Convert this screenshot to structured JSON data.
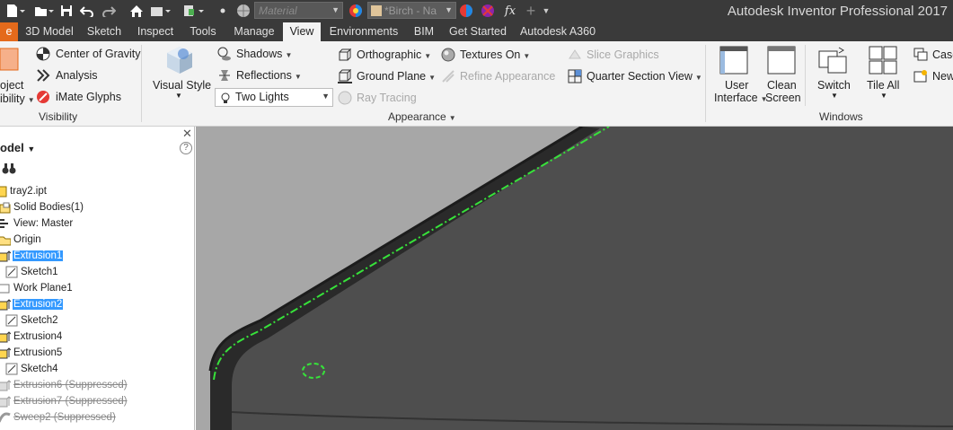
{
  "app_title": "Autodesk Inventor Professional 2017",
  "quick_access": {
    "material_placeholder": "Material",
    "appearance_value": "*Birch - Na",
    "fx_label": "fx"
  },
  "tabs": [
    {
      "label": "e",
      "id": "file"
    },
    {
      "label": "3D Model",
      "id": "3d-model"
    },
    {
      "label": "Sketch",
      "id": "sketch"
    },
    {
      "label": "Inspect",
      "id": "inspect"
    },
    {
      "label": "Tools",
      "id": "tools"
    },
    {
      "label": "Manage",
      "id": "manage"
    },
    {
      "label": "View",
      "id": "view",
      "active": true
    },
    {
      "label": "Environments",
      "id": "environments"
    },
    {
      "label": "BIM",
      "id": "bim"
    },
    {
      "label": "Get Started",
      "id": "get-started"
    },
    {
      "label": "Autodesk A360",
      "id": "a360"
    }
  ],
  "ribbon": {
    "visibility": {
      "title": "Visibility",
      "object_visibility_line1": "oject",
      "object_visibility_line2": "ibility",
      "center_of_gravity": "Center of Gravity",
      "analysis": "Analysis",
      "imate_glyphs": "iMate Glyphs"
    },
    "appearance": {
      "title": "Appearance",
      "visual_style": "Visual Style",
      "shadows": "Shadows",
      "reflections": "Reflections",
      "lighting_value": "Two Lights",
      "orthographic": "Orthographic",
      "ground_plane": "Ground Plane",
      "ray_tracing": "Ray Tracing",
      "textures_on": "Textures On",
      "refine_appearance": "Refine Appearance",
      "slice_graphics": "Slice Graphics",
      "quarter_section_view": "Quarter Section View"
    },
    "windows": {
      "title": "Windows",
      "user_interface_line1": "User",
      "user_interface_line2": "Interface",
      "clean_screen_line1": "Clean",
      "clean_screen_line2": "Screen",
      "switch": "Switch",
      "tile_all": "Tile All",
      "cascade": "Casc",
      "new": "New"
    }
  },
  "browser": {
    "header": "odel",
    "items": [
      {
        "label": "tray2.ipt",
        "state": "normal"
      },
      {
        "label": "Solid Bodies(1)",
        "state": "normal"
      },
      {
        "label": "View: Master",
        "state": "normal"
      },
      {
        "label": "Origin",
        "state": "normal"
      },
      {
        "label": "Extrusion1",
        "state": "selected"
      },
      {
        "label": "Sketch1",
        "state": "normal"
      },
      {
        "label": "Work Plane1",
        "state": "normal"
      },
      {
        "label": "Extrusion2",
        "state": "selected"
      },
      {
        "label": "Sketch2",
        "state": "normal"
      },
      {
        "label": "Extrusion4",
        "state": "normal"
      },
      {
        "label": "Extrusion5",
        "state": "normal"
      },
      {
        "label": "Sketch4",
        "state": "normal"
      },
      {
        "label": "Extrusion6 (Suppressed)",
        "state": "suppressed"
      },
      {
        "label": "Extrusion7 (Suppressed)",
        "state": "suppressed"
      },
      {
        "label": "Sweep2 (Suppressed)",
        "state": "suppressed"
      }
    ]
  },
  "colors": {
    "title_bar": "#3a3a3a",
    "file_tab": "#e46a1b",
    "ribbon": "#f3f3f3",
    "selection": "#3399ff",
    "viewport_background": "#a7a7a7",
    "model_face": "#4e4e4e",
    "model_edge": "#1e1e1e",
    "highlight_edge": "#37e23a"
  }
}
